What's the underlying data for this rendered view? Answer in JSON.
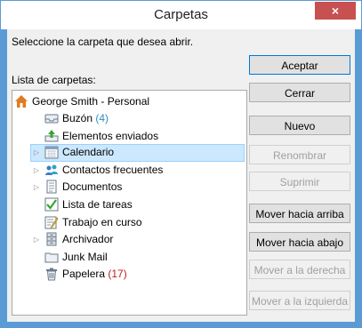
{
  "window": {
    "title": "Carpetas",
    "close_symbol": "×"
  },
  "prompt": "Seleccione la carpeta que desea abrir.",
  "list_label": "Lista de carpetas:",
  "tree": {
    "root": "George Smith - Personal",
    "items": [
      {
        "label": "Buzón",
        "count": "(4)",
        "icon": "inbox-icon"
      },
      {
        "label": "Elementos enviados",
        "icon": "sent-items-icon"
      },
      {
        "label": "Calendario",
        "icon": "calendar-icon",
        "selected": true
      },
      {
        "label": "Contactos frecuentes",
        "icon": "contacts-icon"
      },
      {
        "label": "Documentos",
        "icon": "documents-icon"
      },
      {
        "label": "Lista de tareas",
        "icon": "tasks-icon"
      },
      {
        "label": "Trabajo en curso",
        "icon": "work-in-progress-icon"
      },
      {
        "label": "Archivador",
        "icon": "archive-icon"
      },
      {
        "label": "Junk Mail",
        "icon": "junk-mail-icon"
      },
      {
        "label": "Papelera",
        "count": "(17)",
        "icon": "trash-icon"
      }
    ]
  },
  "buttons": {
    "accept": "Aceptar",
    "close": "Cerrar",
    "new": "Nuevo",
    "rename": "Renombrar",
    "delete": "Suprimir",
    "move_up": "Mover hacia arriba",
    "move_down": "Mover hacia abajo",
    "move_right": "Mover a la derecha",
    "move_left": "Mover a la izquierda"
  },
  "colors": {
    "accent_border": "#5b9bd5",
    "close_button": "#c75050",
    "selection_fill": "#cce8ff",
    "count_blue": "#2e8fb9",
    "count_red": "#c11c1c"
  }
}
